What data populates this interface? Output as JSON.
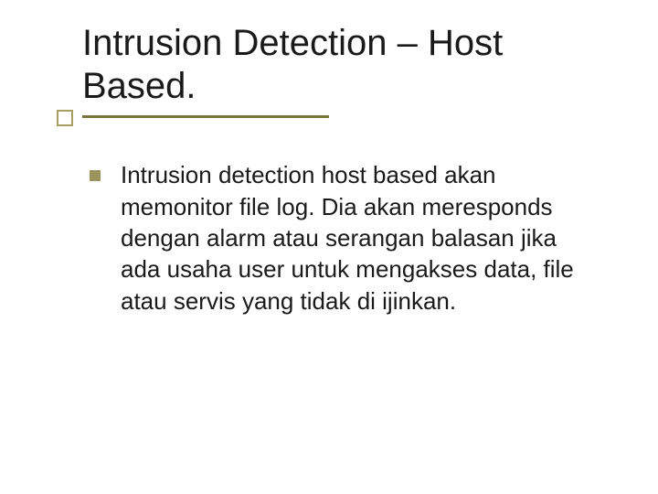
{
  "slide": {
    "title": "Intrusion Detection – Host Based.",
    "bullets": [
      {
        "text": "Intrusion detection host based akan memonitor file log. Dia akan meresponds dengan alarm atau serangan balasan jika ada usaha user untuk mengakses data, file atau servis yang tidak di ijinkan."
      }
    ]
  }
}
